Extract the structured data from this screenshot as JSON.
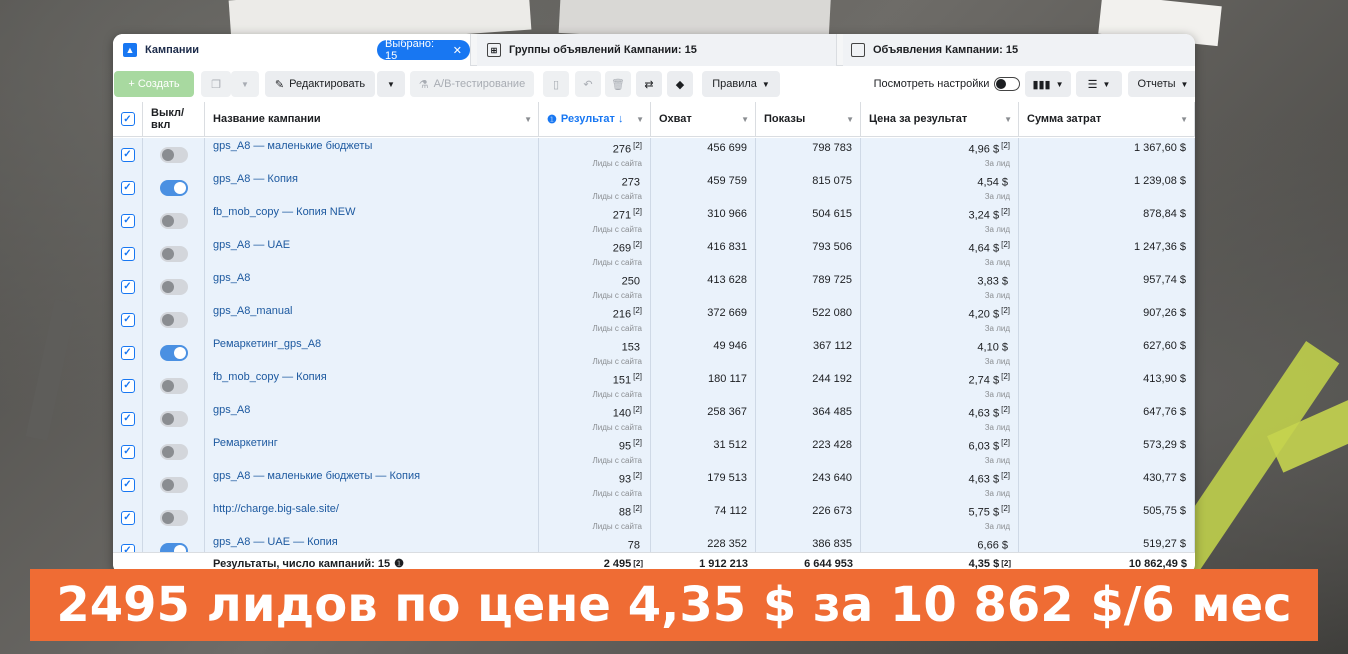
{
  "tabs": {
    "campaigns": "Кампании",
    "selected_badge": "Выбрано: 15",
    "close_glyph": "✕",
    "adsets": "Группы объявлений Кампании: 15",
    "ads": "Объявления Кампании: 15"
  },
  "toolbar": {
    "create": "+ Создать",
    "edit": "Редактировать",
    "ab_test": "A/B-тестирование",
    "rules": "Правила",
    "view_settings": "Посмотреть настройки",
    "reports": "Отчеты"
  },
  "columns": {
    "toggle": "Выкл/ вкл",
    "name": "Название кампании",
    "result": "Результат ↓",
    "reach": "Охват",
    "impressions": "Показы",
    "cpr": "Цена за результат",
    "spend": "Сумма затрат"
  },
  "result_sub": "Лиды с сайта",
  "cpr_sub": "За лид",
  "rows": [
    {
      "name": "gps_A8 — маленькие бюджеты",
      "on": false,
      "result": "276",
      "result_ref": "[2]",
      "reach": "456 699",
      "impressions": "798 783",
      "cpr": "4,96 $",
      "cpr_ref": "[2]",
      "spend": "1 367,60 $"
    },
    {
      "name": "gps_A8 — Копия",
      "on": true,
      "result": "273",
      "result_ref": "",
      "reach": "459 759",
      "impressions": "815 075",
      "cpr": "4,54 $",
      "cpr_ref": "",
      "spend": "1 239,08 $"
    },
    {
      "name": "fb_mob_copy — Копия NEW",
      "on": false,
      "result": "271",
      "result_ref": "[2]",
      "reach": "310 966",
      "impressions": "504 615",
      "cpr": "3,24 $",
      "cpr_ref": "[2]",
      "spend": "878,84 $"
    },
    {
      "name": "gps_A8 — UAE",
      "on": false,
      "result": "269",
      "result_ref": "[2]",
      "reach": "416 831",
      "impressions": "793 506",
      "cpr": "4,64 $",
      "cpr_ref": "[2]",
      "spend": "1 247,36 $"
    },
    {
      "name": "gps_A8",
      "on": false,
      "result": "250",
      "result_ref": "",
      "reach": "413 628",
      "impressions": "789 725",
      "cpr": "3,83 $",
      "cpr_ref": "",
      "spend": "957,74 $"
    },
    {
      "name": "gps_A8_manual",
      "on": false,
      "result": "216",
      "result_ref": "[2]",
      "reach": "372 669",
      "impressions": "522 080",
      "cpr": "4,20 $",
      "cpr_ref": "[2]",
      "spend": "907,26 $"
    },
    {
      "name": "Ремаркетинг_gps_A8",
      "on": true,
      "result": "153",
      "result_ref": "",
      "reach": "49 946",
      "impressions": "367 112",
      "cpr": "4,10 $",
      "cpr_ref": "",
      "spend": "627,60 $"
    },
    {
      "name": "fb_mob_copy — Копия",
      "on": false,
      "result": "151",
      "result_ref": "[2]",
      "reach": "180 117",
      "impressions": "244 192",
      "cpr": "2,74 $",
      "cpr_ref": "[2]",
      "spend": "413,90 $"
    },
    {
      "name": "gps_A8",
      "on": false,
      "result": "140",
      "result_ref": "[2]",
      "reach": "258 367",
      "impressions": "364 485",
      "cpr": "4,63 $",
      "cpr_ref": "[2]",
      "spend": "647,76 $"
    },
    {
      "name": "Ремаркетинг",
      "on": false,
      "result": "95",
      "result_ref": "[2]",
      "reach": "31 512",
      "impressions": "223 428",
      "cpr": "6,03 $",
      "cpr_ref": "[2]",
      "spend": "573,29 $"
    },
    {
      "name": "gps_A8 — маленькие бюджеты — Копия",
      "on": false,
      "result": "93",
      "result_ref": "[2]",
      "reach": "179 513",
      "impressions": "243 640",
      "cpr": "4,63 $",
      "cpr_ref": "[2]",
      "spend": "430,77 $"
    },
    {
      "name": "http://charge.big-sale.site/",
      "on": false,
      "result": "88",
      "result_ref": "[2]",
      "reach": "74 112",
      "impressions": "226 673",
      "cpr": "5,75 $",
      "cpr_ref": "[2]",
      "spend": "505,75 $"
    },
    {
      "name": "gps_A8 — UAE — Копия",
      "on": true,
      "result": "78",
      "result_ref": "",
      "reach": "228 352",
      "impressions": "386 835",
      "cpr": "6,66 $",
      "cpr_ref": "",
      "spend": "519,27 $"
    }
  ],
  "footer": {
    "label": "Результаты, число кампаний: 15",
    "info_glyph": "❶",
    "result": "2 495",
    "result_ref": "[2]",
    "reach": "1 912 213",
    "impressions": "6 644 953",
    "cpr": "4,35 $",
    "cpr_ref": "[2]",
    "spend": "10 862,49 $"
  },
  "banner": "2495 лидов по цене 4,35 $ за 10 862 $/6 мес"
}
